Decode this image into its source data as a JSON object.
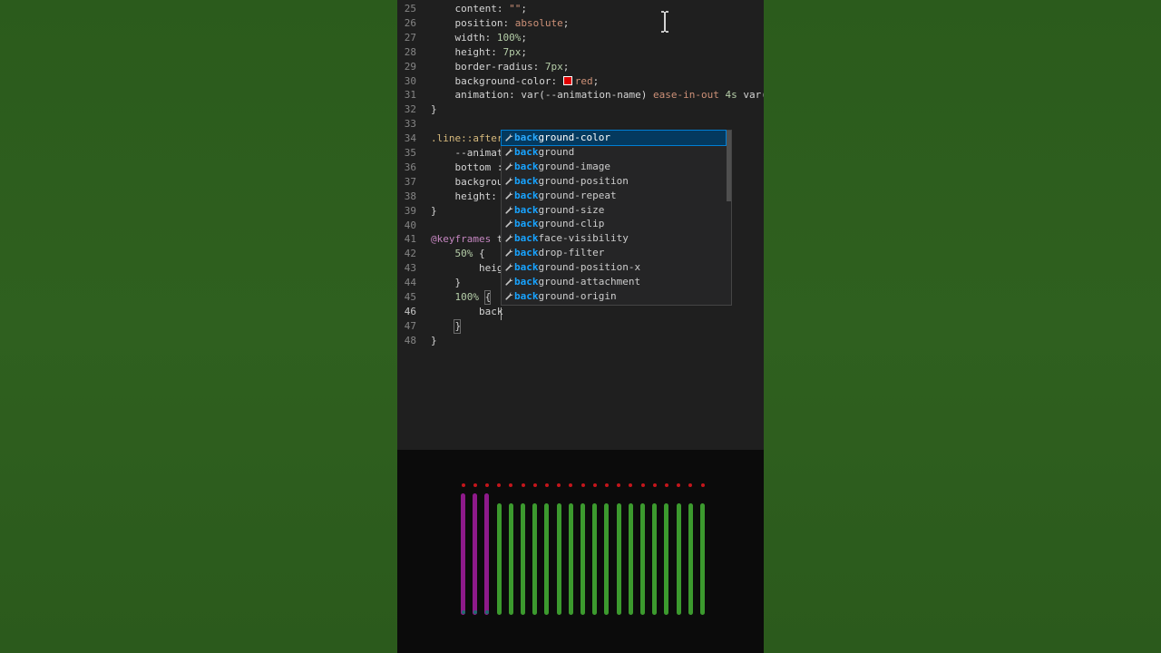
{
  "editor": {
    "lines": [
      {
        "num": "25",
        "tokens": [
          [
            "prop",
            "    content: "
          ],
          [
            "str",
            "\"\""
          ],
          [
            "prop",
            ";"
          ]
        ]
      },
      {
        "num": "26",
        "tokens": [
          [
            "prop",
            "    position: "
          ],
          [
            "val",
            "absolute"
          ],
          [
            "prop",
            ";"
          ]
        ]
      },
      {
        "num": "27",
        "tokens": [
          [
            "prop",
            "    width: "
          ],
          [
            "num",
            "100%"
          ],
          [
            "prop",
            ";"
          ]
        ]
      },
      {
        "num": "28",
        "tokens": [
          [
            "prop",
            "    height: "
          ],
          [
            "num",
            "7px"
          ],
          [
            "prop",
            ";"
          ]
        ]
      },
      {
        "num": "29",
        "tokens": [
          [
            "prop",
            "    border-radius: "
          ],
          [
            "num",
            "7px"
          ],
          [
            "prop",
            ";"
          ]
        ]
      },
      {
        "num": "30",
        "tokens": [
          [
            "prop",
            "    background-color: "
          ],
          [
            "swatch",
            ""
          ],
          [
            "val",
            "red"
          ],
          [
            "prop",
            ";"
          ]
        ]
      },
      {
        "num": "31",
        "tokens": [
          [
            "prop",
            "    animation: var(--animation-name) "
          ],
          [
            "val",
            "ease-in-out"
          ],
          [
            "prop",
            " "
          ],
          [
            "num",
            "4s"
          ],
          [
            "prop",
            " var(-"
          ]
        ]
      },
      {
        "num": "32",
        "tokens": [
          [
            "prop",
            "}"
          ]
        ]
      },
      {
        "num": "33",
        "tokens": []
      },
      {
        "num": "34",
        "tokens": [
          [
            "sel",
            ".line::after"
          ]
        ]
      },
      {
        "num": "35",
        "tokens": [
          [
            "prop",
            "    --animat"
          ]
        ]
      },
      {
        "num": "36",
        "tokens": [
          [
            "prop",
            "    bottom :"
          ]
        ]
      },
      {
        "num": "37",
        "tokens": [
          [
            "prop",
            "    backgrou"
          ]
        ]
      },
      {
        "num": "38",
        "tokens": [
          [
            "prop",
            "    height: "
          ]
        ]
      },
      {
        "num": "39",
        "tokens": [
          [
            "prop",
            "}"
          ]
        ]
      },
      {
        "num": "40",
        "tokens": []
      },
      {
        "num": "41",
        "tokens": [
          [
            "at",
            "@keyframes"
          ],
          [
            "prop",
            " t"
          ]
        ]
      },
      {
        "num": "42",
        "tokens": [
          [
            "prop",
            "    "
          ],
          [
            "num",
            "50%"
          ],
          [
            "prop",
            " {"
          ]
        ]
      },
      {
        "num": "43",
        "tokens": [
          [
            "prop",
            "        heig"
          ]
        ]
      },
      {
        "num": "44",
        "tokens": [
          [
            "prop",
            "    }"
          ]
        ]
      },
      {
        "num": "45",
        "tokens": [
          [
            "prop",
            "    "
          ],
          [
            "num",
            "100%"
          ],
          [
            "prop",
            " {"
          ]
        ]
      },
      {
        "num": "46",
        "tokens": [
          [
            "prop",
            "        back"
          ]
        ]
      },
      {
        "num": "47",
        "tokens": [
          [
            "prop",
            "    }"
          ]
        ]
      },
      {
        "num": "48",
        "tokens": [
          [
            "prop",
            "}"
          ]
        ]
      }
    ],
    "current_line": "46"
  },
  "suggest": {
    "typed": "back",
    "items": [
      {
        "match": "back",
        "rest": "ground-color",
        "active": true
      },
      {
        "match": "back",
        "rest": "ground",
        "active": false
      },
      {
        "match": "back",
        "rest": "ground-image",
        "active": false
      },
      {
        "match": "back",
        "rest": "ground-position",
        "active": false
      },
      {
        "match": "back",
        "rest": "ground-repeat",
        "active": false
      },
      {
        "match": "back",
        "rest": "ground-size",
        "active": false
      },
      {
        "match": "back",
        "rest": "ground-clip",
        "active": false
      },
      {
        "match": "back",
        "rest": "face-visibility",
        "active": false
      },
      {
        "match": "back",
        "rest": "drop-filter",
        "active": false
      },
      {
        "match": "back",
        "rest": "ground-position-x",
        "active": false
      },
      {
        "match": "back",
        "rest": "ground-attachment",
        "active": false
      },
      {
        "match": "back",
        "rest": "ground-origin",
        "active": false
      }
    ],
    "icon": "wrench-icon"
  },
  "preview": {
    "bars": [
      {
        "color": "#8e1a8a",
        "level": 0.89
      },
      {
        "color": "#8e1a8a",
        "level": 0.89
      },
      {
        "color": "#8e1a8a",
        "level": 0.89
      },
      {
        "color": "#3c9a2e",
        "level": 0.82
      },
      {
        "color": "#3c9a2e",
        "level": 0.82
      },
      {
        "color": "#3c9a2e",
        "level": 0.82
      },
      {
        "color": "#3c9a2e",
        "level": 0.82
      },
      {
        "color": "#3c9a2e",
        "level": 0.82
      },
      {
        "color": "#3c9a2e",
        "level": 0.82
      },
      {
        "color": "#3c9a2e",
        "level": 0.82
      },
      {
        "color": "#3c9a2e",
        "level": 0.82
      },
      {
        "color": "#3c9a2e",
        "level": 0.82
      },
      {
        "color": "#3c9a2e",
        "level": 0.82
      },
      {
        "color": "#3c9a2e",
        "level": 0.82
      },
      {
        "color": "#3c9a2e",
        "level": 0.82
      },
      {
        "color": "#3c9a2e",
        "level": 0.82
      },
      {
        "color": "#3c9a2e",
        "level": 0.82
      },
      {
        "color": "#3c9a2e",
        "level": 0.82
      },
      {
        "color": "#3c9a2e",
        "level": 0.82
      },
      {
        "color": "#3c9a2e",
        "level": 0.82
      },
      {
        "color": "#3c9a2e",
        "level": 0.82
      }
    ],
    "top_dot_color": "#c4161c",
    "bottom_dot_color": "#1e6e6e"
  }
}
